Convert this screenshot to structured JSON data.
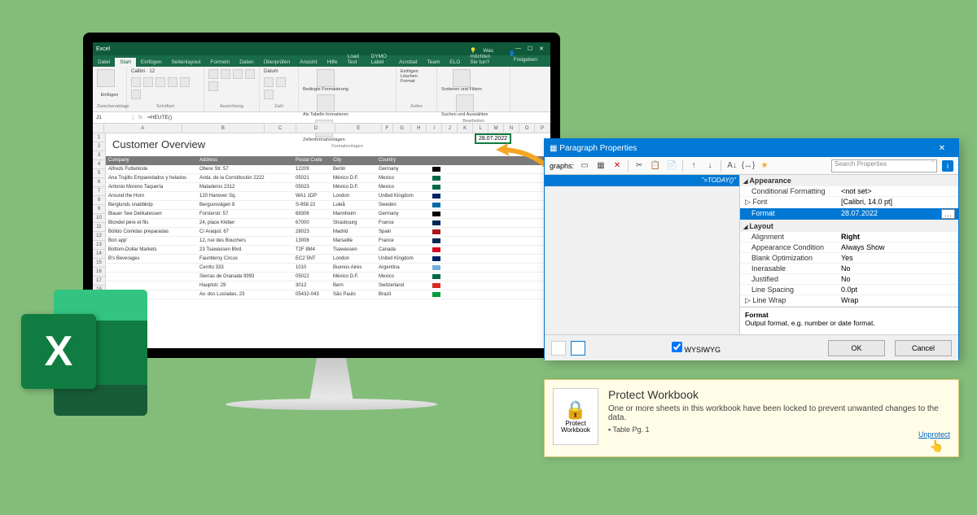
{
  "excel": {
    "window": {
      "title": "Excel"
    },
    "tabs": {
      "file": "Datei",
      "home": "Start",
      "insert": "Einfügen",
      "layout": "Seitenlayout",
      "formulas": "Formeln",
      "data": "Daten",
      "review": "Überprüfen",
      "view": "Ansicht",
      "help": "Hilfe",
      "loadtest": "Load Test",
      "dymo": "DYMO Label",
      "acrobat": "Acrobat",
      "team": "Team",
      "elo": "ELO",
      "tellme": "Was möchten Sie tun?",
      "share": "Freigeben"
    },
    "ribbon": {
      "clipboard": "Zwischenablage",
      "paste": "Einfügen",
      "font_group": "Schriftart",
      "font_name": "Calibri",
      "font_size": "12",
      "align_group": "Ausrichtung",
      "number_group": "Zahl",
      "number_format": "Datum",
      "cond": "Bedingte Formatierung",
      "as_table": "Als Tabelle formatieren",
      "cell_styles": "Zellenformatvorlagen",
      "styles_group": "Formatvorlagen",
      "insert_cells": "Einfügen",
      "delete_cells": "Löschen",
      "format_cells": "Format",
      "cells_group": "Zellen",
      "sort": "Sortieren und Filtern",
      "find": "Suchen und Auswählen",
      "edit_group": "Bearbeiten"
    },
    "formula_bar": {
      "ref": "J1",
      "formula": "=HEUTE()"
    },
    "sheet": {
      "title": "Customer Overview",
      "date": "28.07.2022",
      "columns": [
        "A",
        "B",
        "C",
        "D",
        "E",
        "F",
        "G",
        "H",
        "I",
        "J",
        "K",
        "L",
        "M",
        "N",
        "O",
        "P"
      ],
      "headers": {
        "company": "Company",
        "address": "Address",
        "postal": "Postal Code",
        "city": "City",
        "country": "Country"
      },
      "rows": [
        {
          "company": "Alfreds Futterkiste",
          "address": "Obere Str. 57",
          "postal": "12209",
          "city": "Berlin",
          "country": "Germany",
          "flag": "#000"
        },
        {
          "company": "Ana Trujillo Emparedados y helados",
          "address": "Avda. de la Constitución 2222",
          "postal": "05021",
          "city": "México D.F.",
          "country": "Mexico",
          "flag": "#006847"
        },
        {
          "company": "Antonio Moreno Taquería",
          "address": "Mataderos 2312",
          "postal": "05023",
          "city": "México D.F.",
          "country": "Mexico",
          "flag": "#006847"
        },
        {
          "company": "Around the Horn",
          "address": "120 Hanover Sq.",
          "postal": "WA1 1DP",
          "city": "London",
          "country": "United Kingdom",
          "flag": "#012169"
        },
        {
          "company": "Berglunds snabbköp",
          "address": "Berguvsvägen 8",
          "postal": "S-958 22",
          "city": "Luleå",
          "country": "Sweden",
          "flag": "#006aa7"
        },
        {
          "company": "Blauer See Delikatessen",
          "address": "Forsterstr. 57",
          "postal": "68306",
          "city": "Mannheim",
          "country": "Germany",
          "flag": "#000"
        },
        {
          "company": "Blondel père et fils",
          "address": "24, place Kléber",
          "postal": "67000",
          "city": "Strasbourg",
          "country": "France",
          "flag": "#002654"
        },
        {
          "company": "Bólido Comidas preparadas",
          "address": "C/ Araquil, 67",
          "postal": "28023",
          "city": "Madrid",
          "country": "Spain",
          "flag": "#aa151b"
        },
        {
          "company": "Bon app'",
          "address": "12, rue des Bouchers",
          "postal": "13008",
          "city": "Marseille",
          "country": "France",
          "flag": "#002654"
        },
        {
          "company": "Bottom-Dollar Markets",
          "address": "23 Tsawassen Blvd.",
          "postal": "T2F 8M4",
          "city": "Tsawassen",
          "country": "Canada",
          "flag": "#d80621"
        },
        {
          "company": "B's Beverages",
          "address": "Fauntleroy Circus",
          "postal": "EC2 5NT",
          "city": "London",
          "country": "United Kingdom",
          "flag": "#012169"
        },
        {
          "company": "",
          "address": "Cerrito 333",
          "postal": "1010",
          "city": "Buenos Aires",
          "country": "Argentina",
          "flag": "#74acdf"
        },
        {
          "company": "",
          "address": "Sierras de Granada 9993",
          "postal": "05022",
          "city": "México D.F.",
          "country": "Mexico",
          "flag": "#006847"
        },
        {
          "company": "",
          "address": "Hauptstr. 29",
          "postal": "3012",
          "city": "Bern",
          "country": "Switzerland",
          "flag": "#d52b1e"
        },
        {
          "company": "",
          "address": "Av. dos Lusíadas, 23",
          "postal": "05432-043",
          "city": "São Paulo",
          "country": "Brazil",
          "flag": "#009b3a"
        }
      ]
    }
  },
  "dialog": {
    "title": "Paragraph Properties",
    "paragraphs_label": "graphs:",
    "formula": "\"=TODAY()\"",
    "search_placeholder": "Search Properties",
    "wysiwyg": "WYSIWYG",
    "ok": "OK",
    "cancel": "Cancel",
    "sections": {
      "appearance": "Appearance",
      "layout": "Layout"
    },
    "props": {
      "cond_fmt": {
        "k": "Conditional Formatting",
        "v": "<not set>"
      },
      "font": {
        "k": "Font",
        "v": "[Calibri, 14.0 pt]"
      },
      "format": {
        "k": "Format",
        "v": "28.07.2022"
      },
      "align": {
        "k": "Alignment",
        "v": "Right"
      },
      "app_cond": {
        "k": "Appearance Condition",
        "v": "Always Show"
      },
      "blank": {
        "k": "Blank Optimization",
        "v": "Yes"
      },
      "ineras": {
        "k": "Inerasable",
        "v": "No"
      },
      "just": {
        "k": "Justified",
        "v": "No"
      },
      "linesp": {
        "k": "Line Spacing",
        "v": "0.0pt"
      },
      "linewrap": {
        "k": "Line Wrap",
        "v": "Wrap"
      }
    },
    "desc": {
      "title": "Format",
      "text": "Output format, e.g. number or date format."
    }
  },
  "protect": {
    "button": "Protect Workbook",
    "title": "Protect Workbook",
    "text": "One or more sheets in this workbook have been locked to prevent unwanted changes to the data.",
    "sheet": "Table Pg. 1",
    "link": "Unprotect"
  },
  "logo": {
    "letter": "X"
  }
}
